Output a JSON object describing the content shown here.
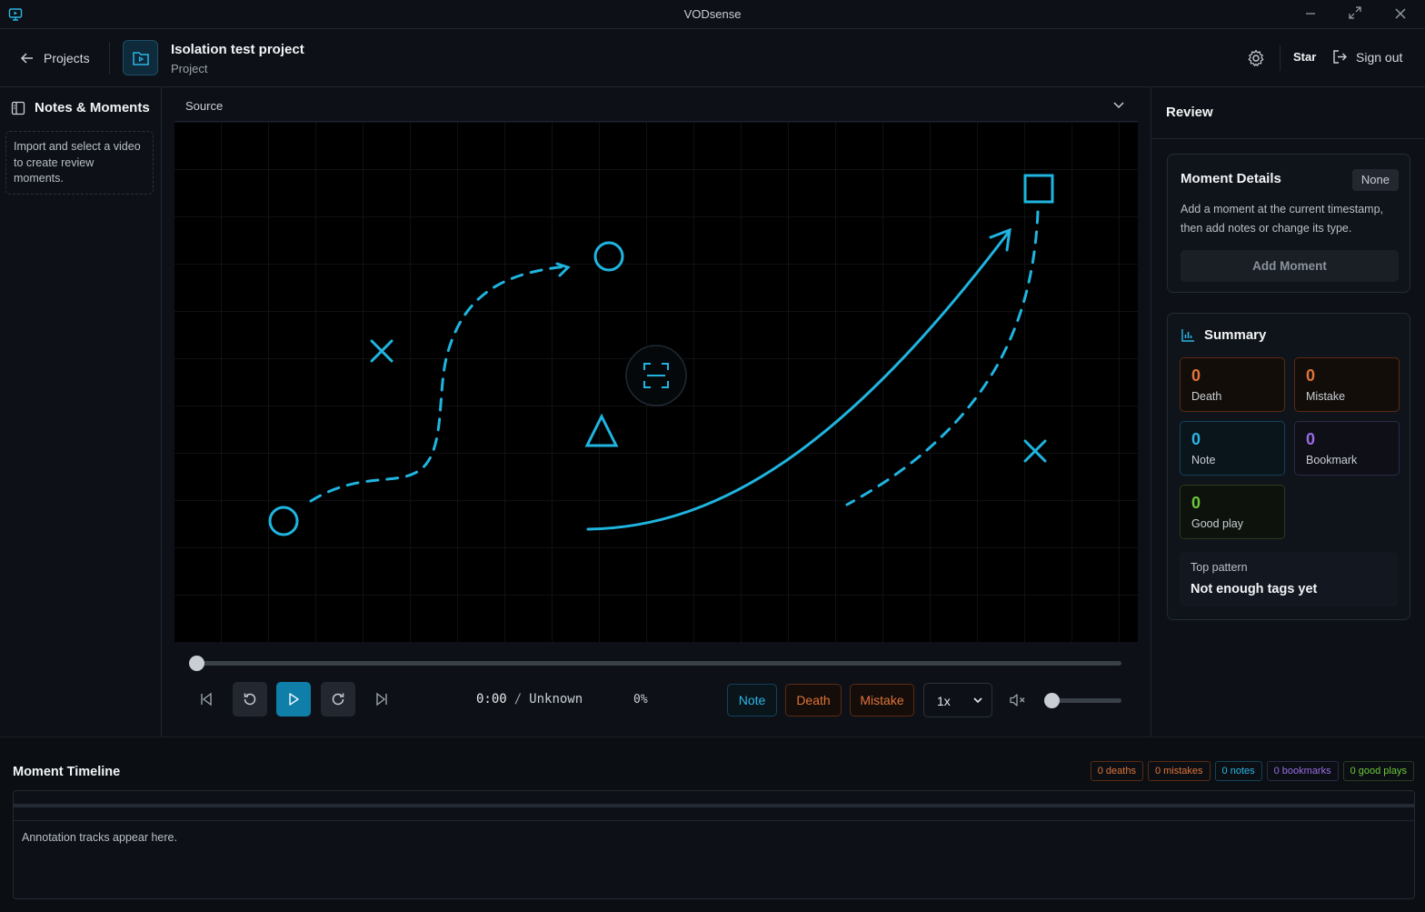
{
  "window": {
    "title": "VODsense"
  },
  "header": {
    "back_label": "Projects",
    "project_title": "Isolation test project",
    "project_subtitle": "Project",
    "star_label": "Star",
    "signout_label": "Sign out"
  },
  "sidebar": {
    "title": "Notes & Moments",
    "hint": "Import and select a video to create review moments."
  },
  "source": {
    "label": "Source"
  },
  "player": {
    "current_time": "0:00",
    "separator": "/",
    "duration": "Unknown",
    "percent": "0%",
    "progress": 0,
    "volume": 0,
    "speed": "1x",
    "tag_buttons": {
      "note": "Note",
      "death": "Death",
      "mistake": "Mistake"
    }
  },
  "review": {
    "title": "Review",
    "moment_details": {
      "title": "Moment Details",
      "badge": "None",
      "description": "Add a moment at the current timestamp, then add notes or change its type.",
      "add_button": "Add Moment"
    },
    "summary": {
      "title": "Summary",
      "stats": [
        {
          "count": "0",
          "label": "Death"
        },
        {
          "count": "0",
          "label": "Mistake"
        },
        {
          "count": "0",
          "label": "Note"
        },
        {
          "count": "0",
          "label": "Bookmark"
        },
        {
          "count": "0",
          "label": "Good play"
        }
      ],
      "top_pattern_label": "Top pattern",
      "top_pattern_value": "Not enough tags yet"
    }
  },
  "timeline": {
    "title": "Moment Timeline",
    "pills": [
      "0 deaths",
      "0 mistakes",
      "0 notes",
      "0 bookmarks",
      "0 good plays"
    ],
    "empty_message": "Annotation tracks appear here."
  },
  "colors": {
    "accent": "#2bb6e6",
    "death": "#e0743a",
    "mistake": "#e0743a",
    "bookmark": "#9a6ce6",
    "good_play": "#6cc93a",
    "play_button": "#0f7ea8"
  }
}
